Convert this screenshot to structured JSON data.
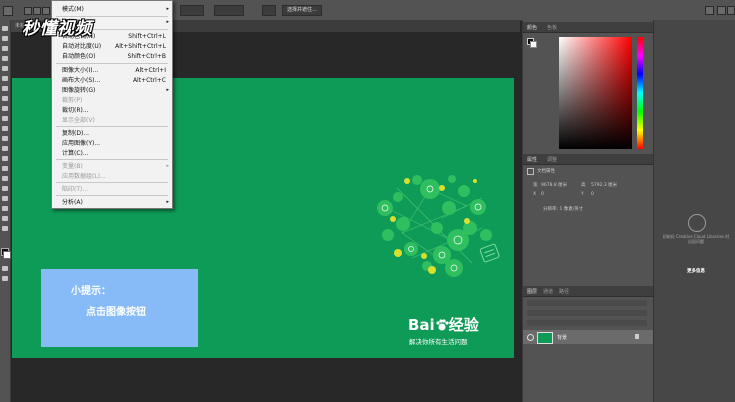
{
  "watermark": "秒懂视频",
  "options_bar": {
    "button_label": "选择并遮住..."
  },
  "document_tab": "未标题-1 @ 66.7% (RGB/8)",
  "image_menu": {
    "items": [
      {
        "label": "模式(M)",
        "submenu": true
      },
      {
        "label": "调整(J)",
        "submenu": true
      },
      {
        "label": "自动色调(N)",
        "shortcut": "Shift+Ctrl+L"
      },
      {
        "label": "自动对比度(U)",
        "shortcut": "Alt+Shift+Ctrl+L"
      },
      {
        "label": "自动颜色(O)",
        "shortcut": "Shift+Ctrl+B"
      },
      {
        "label": "图像大小(I)...",
        "shortcut": "Alt+Ctrl+I"
      },
      {
        "label": "画布大小(S)...",
        "shortcut": "Alt+Ctrl+C"
      },
      {
        "label": "图像旋转(G)",
        "submenu": true
      },
      {
        "label": "裁剪(P)",
        "disabled": true
      },
      {
        "label": "裁切(R)..."
      },
      {
        "label": "显示全部(V)",
        "disabled": true
      },
      {
        "label": "复制(D)..."
      },
      {
        "label": "应用图像(Y)..."
      },
      {
        "label": "计算(C)..."
      },
      {
        "label": "变量(B)",
        "submenu": true,
        "disabled": true
      },
      {
        "label": "应用数据组(L)...",
        "disabled": true
      },
      {
        "label": "陷印(T)...",
        "disabled": true
      },
      {
        "label": "分析(A)",
        "submenu": true
      }
    ]
  },
  "canvas": {
    "hint_title": "小提示：",
    "hint_text": "点击图像按钮",
    "brand_text_1": "Bai",
    "brand_text_2": "经验",
    "brand_slogan": "解决你所有生活问题"
  },
  "panels": {
    "color_tab": "颜色",
    "swatches_tab": "色板",
    "properties_tab": "属性",
    "adjustments_tab": "调整",
    "doc_props_label": "文档属性",
    "w_label": "宽",
    "w_value": "9678.8 厘米",
    "h_label": "高",
    "h_value": "5792.3 厘米",
    "x_label": "X",
    "x_value": "0",
    "y_label": "Y",
    "y_value": "0",
    "resolution": "分辨率: 1 像素/英寸",
    "layers_tab": "图层",
    "channels_tab": "通道",
    "paths_tab": "路径",
    "layer_name": "背景"
  },
  "libraries": {
    "message": "初始化 Creative Cloud Libraries 时出现问题",
    "link": "更多信息"
  },
  "colors": {
    "canvas_green": "#0e9b57",
    "hint_blue": "#87bbf8",
    "ui_gray": "#535353"
  }
}
